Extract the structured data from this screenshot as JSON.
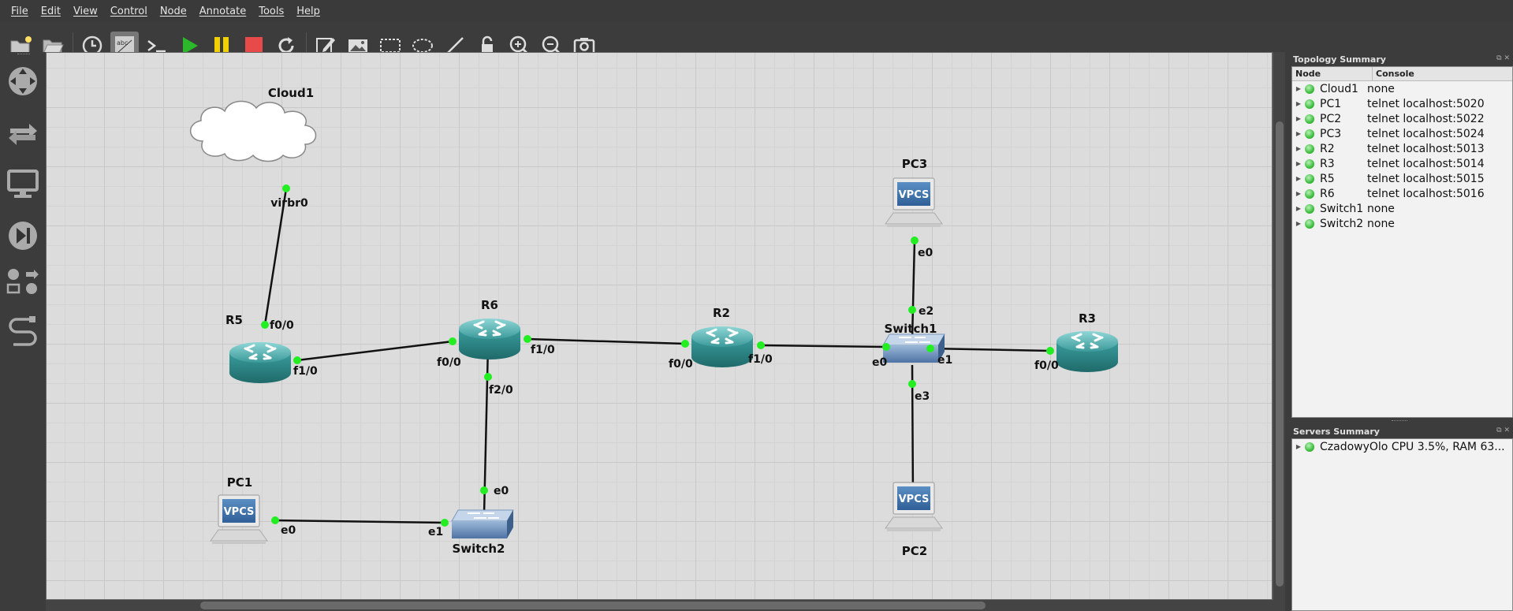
{
  "menu": [
    "File",
    "Edit",
    "View",
    "Control",
    "Node",
    "Annotate",
    "Tools",
    "Help"
  ],
  "toolbar": [
    {
      "name": "new-project-icon"
    },
    {
      "name": "open-project-icon"
    },
    {
      "name": "snapshot-clock-icon"
    },
    {
      "name": "show-interface-labels-icon",
      "active": true
    },
    {
      "name": "console-all-icon"
    },
    {
      "name": "start-all-icon"
    },
    {
      "name": "suspend-all-icon"
    },
    {
      "name": "stop-all-icon"
    },
    {
      "name": "reload-all-icon"
    },
    {
      "name": "add-note-icon"
    },
    {
      "name": "insert-image-icon"
    },
    {
      "name": "draw-rectangle-icon"
    },
    {
      "name": "draw-ellipse-icon"
    },
    {
      "name": "draw-line-icon"
    },
    {
      "name": "lock-icon"
    },
    {
      "name": "zoom-in-icon"
    },
    {
      "name": "zoom-out-icon"
    },
    {
      "name": "screenshot-icon"
    }
  ],
  "colors": {
    "port_green": "#22ee22",
    "router_teal": "#2f8f8f",
    "switch_blue": "#5a82b4"
  },
  "nodes": {
    "cloud1": {
      "name": "Cloud1",
      "port": "virbr0"
    },
    "r5": {
      "name": "R5",
      "port_a": "f0/0",
      "port_b": "f1/0"
    },
    "r6": {
      "name": "R6",
      "port_a": "f0/0",
      "port_b": "f1/0",
      "port_c": "f2/0"
    },
    "r2": {
      "name": "R2",
      "port_a": "f0/0",
      "port_b": "f1/0"
    },
    "switch1": {
      "name": "Switch1",
      "port_e0": "e0",
      "port_e1": "e1",
      "port_e2": "e2",
      "port_e3": "e3"
    },
    "r3": {
      "name": "R3",
      "port_a": "f0/0"
    },
    "pc3": {
      "name": "PC3",
      "port": "e0",
      "badge": "VPCS"
    },
    "pc2": {
      "name": "PC2",
      "port": "e0",
      "badge": "VPCS"
    },
    "pc1": {
      "name": "PC1",
      "port": "e0",
      "badge": "VPCS"
    },
    "switch2": {
      "name": "Switch2",
      "port_e0": "e0",
      "port_e1": "e1"
    }
  },
  "topology_summary": {
    "title": "Topology Summary",
    "col_node": "Node",
    "col_console": "Console",
    "rows": [
      {
        "node": "Cloud1",
        "console": "none"
      },
      {
        "node": "PC1",
        "console": "telnet localhost:5020"
      },
      {
        "node": "PC2",
        "console": "telnet localhost:5022"
      },
      {
        "node": "PC3",
        "console": "telnet localhost:5024"
      },
      {
        "node": "R2",
        "console": "telnet localhost:5013"
      },
      {
        "node": "R3",
        "console": "telnet localhost:5014"
      },
      {
        "node": "R5",
        "console": "telnet localhost:5015"
      },
      {
        "node": "R6",
        "console": "telnet localhost:5016"
      },
      {
        "node": "Switch1",
        "console": "none"
      },
      {
        "node": "Switch2",
        "console": "none"
      }
    ]
  },
  "servers_summary": {
    "title": "Servers Summary",
    "rows": [
      {
        "text": "CzadowyOlo CPU 3.5%, RAM 63..."
      }
    ]
  }
}
